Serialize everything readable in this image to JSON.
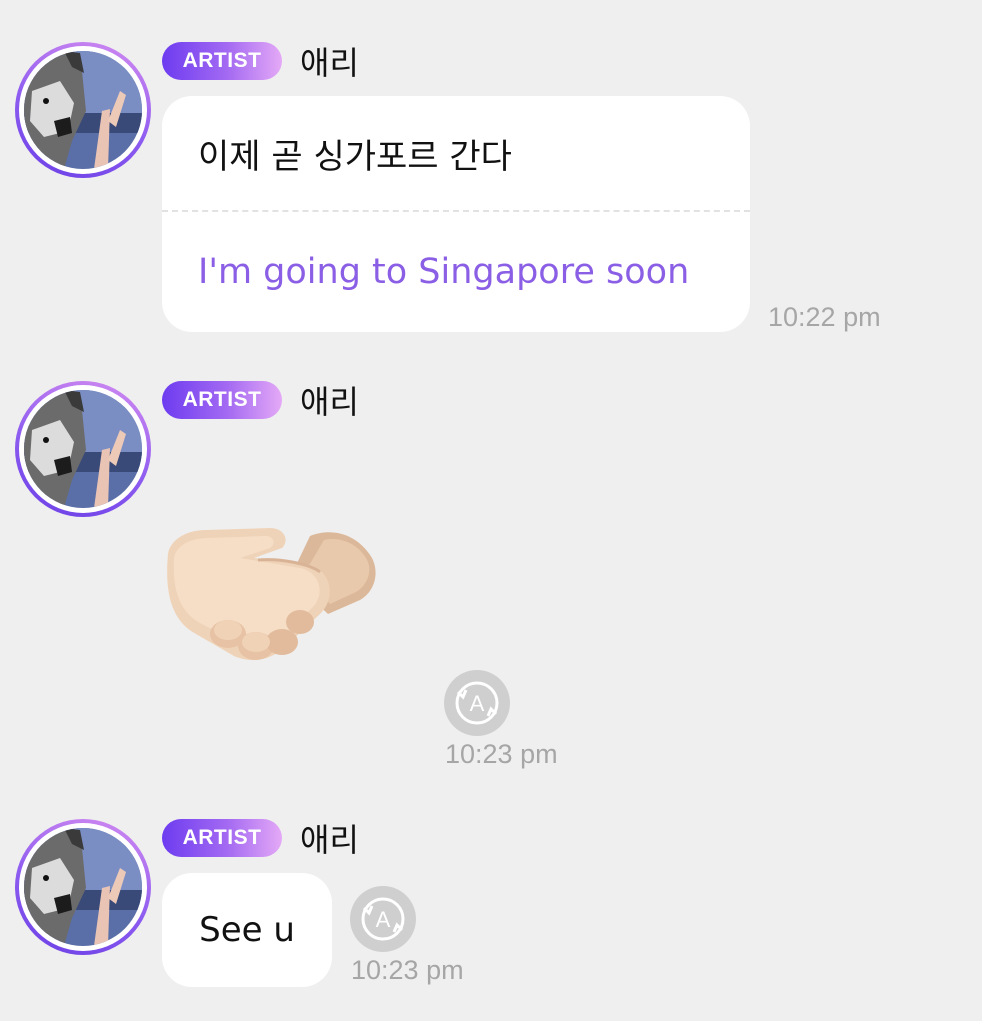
{
  "messages": [
    {
      "badge": "ARTIST",
      "sender": "애리",
      "original_text": "이제 곧 싱가포르 간다",
      "translated_text": "I'm going to Singapore soon",
      "time": "10:22 pm"
    },
    {
      "badge": "ARTIST",
      "sender": "애리",
      "emoji": "handshake",
      "time": "10:23 pm"
    },
    {
      "badge": "ARTIST",
      "sender": "애리",
      "text": "See u",
      "time": "10:23 pm"
    }
  ],
  "translate_icon_letter": "A",
  "colors": {
    "background": "#efefef",
    "badge_start": "#6d3cf0",
    "badge_end": "#e4a9f6",
    "translation_text": "#8b5fe5",
    "timestamp": "#a6a6a6",
    "bubble": "#ffffff"
  }
}
